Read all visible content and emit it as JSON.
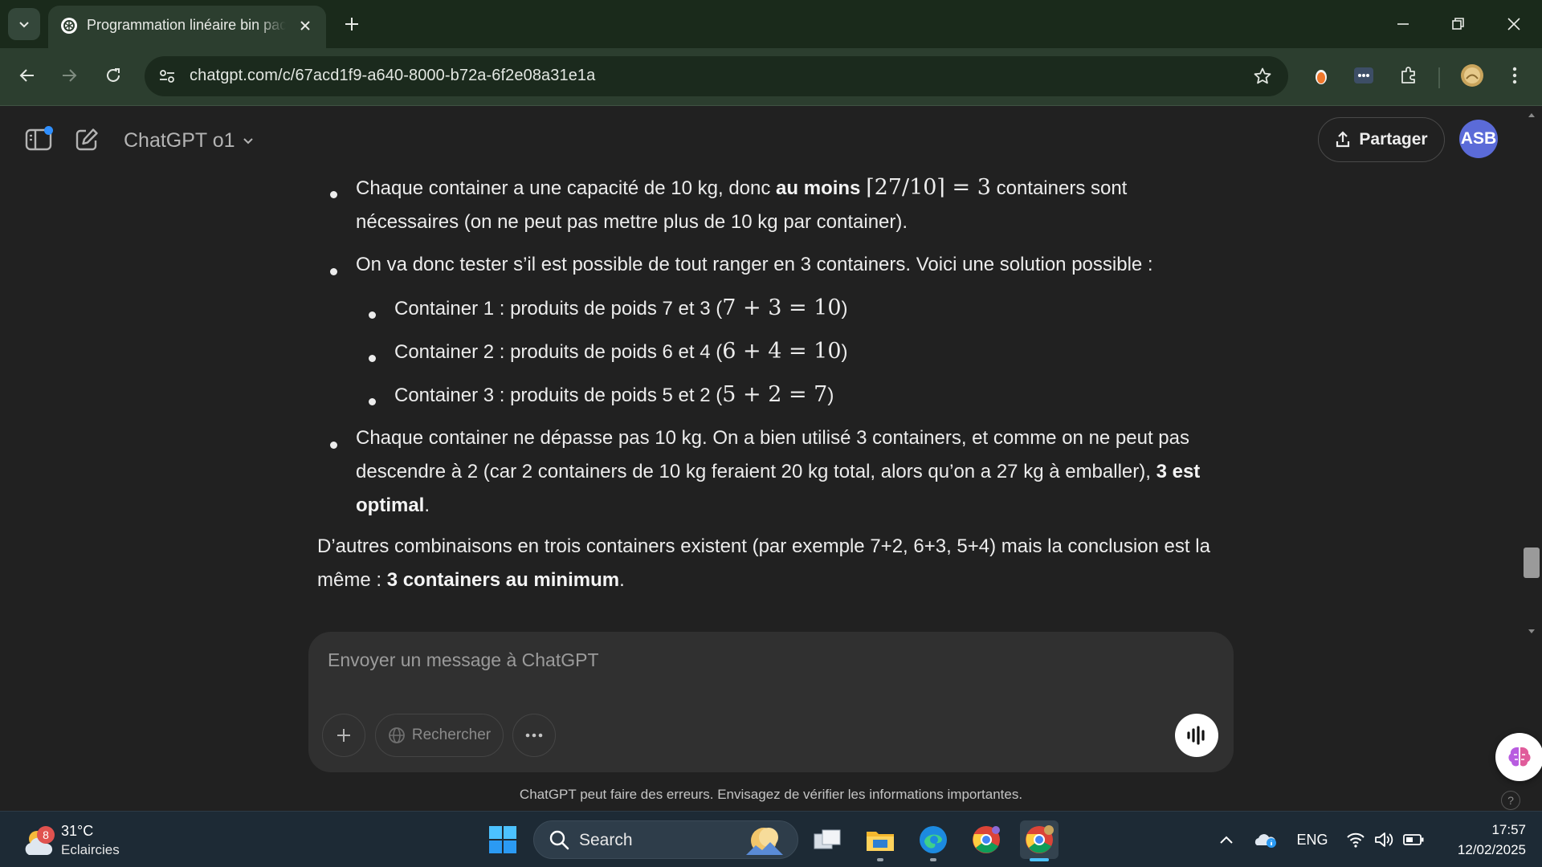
{
  "browser": {
    "tab_title": "Programmation linéaire bin packing",
    "url": "chatgpt.com/c/67acd1f9-a640-8000-b72a-6f2e08a31e1a",
    "accent": "#2c3e2f"
  },
  "app": {
    "model_name": "ChatGPT o1",
    "share_label": "Partager",
    "avatar_initials": "ASB"
  },
  "message": {
    "b1_pre": "Chaque container a une capacité de 10 kg, donc ",
    "b1_bold": "au moins",
    "b1_math": "⌈27/10⌉ = 3",
    "b1_post": " containers sont",
    "b1_line2": "nécessaires (on ne peut pas mettre plus de 10 kg par container).",
    "b2": "On va donc tester s’il est possible de tout ranger en 3 containers. Voici une solution possible :",
    "sub1_text": "Container 1 : produits de poids 7 et 3 (",
    "sub1_math": "7 + 3 = 10",
    "sub2_text": "Container 2 : produits de poids 6 et 4 (",
    "sub2_math": "6 + 4 = 10",
    "sub3_text": "Container 3 : produits de poids 5 et 2 (",
    "sub3_math": "5 + 2 = 7",
    "close_paren": ")",
    "b3_line1": "Chaque container ne dépasse pas 10 kg. On a bien utilisé 3 containers, et comme on ne peut pas",
    "b3_line2_pre": "descendre à 2 (car 2 containers de 10 kg feraient 20 kg total, alors qu’on a 27 kg à emballer), ",
    "b3_line2_bold": "3 est",
    "b3_line3_bold": "optimal",
    "b3_line3_post": ".",
    "p_line1": "D’autres combinaisons en trois containers existent (par exemple 7+2, 6+3, 5+4) mais la conclusion est la",
    "p_line2_pre": "même : ",
    "p_line2_bold": "3 containers au minimum",
    "p_line2_post": "."
  },
  "composer": {
    "placeholder": "Envoyer un message à ChatGPT",
    "search_label": "Rechercher"
  },
  "disclaimer": "ChatGPT peut faire des erreurs. Envisagez de vérifier les informations importantes.",
  "taskbar": {
    "weather_badge": "8",
    "temperature": "31°C",
    "condition": "Eclaircies",
    "search_label": "Search",
    "language": "ENG",
    "time": "17:57",
    "date": "12/02/2025"
  }
}
